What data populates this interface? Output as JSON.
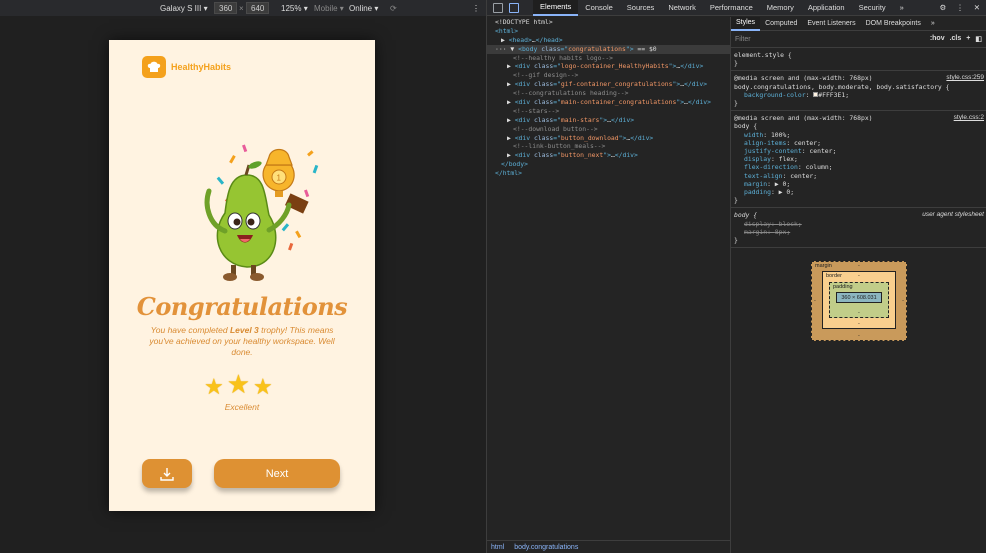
{
  "devbar": {
    "device": "Galaxy S III",
    "width": "360",
    "times": "×",
    "height": "640",
    "zoom": "125%",
    "mode": "Mobile",
    "throttle": "Online"
  },
  "app": {
    "logo_text": "HealthyHabits",
    "heading": "Congratulations",
    "message_pre": "You have completed ",
    "message_bold": "Level 3",
    "message_post": " trophy! This means you've achieved on your healthy workspace. Well done.",
    "rating_label": "Excellent",
    "next_label": "Next",
    "stars": [
      "★",
      "★",
      "★"
    ],
    "colors": {
      "background": "#FFF3E1",
      "accent": "#DE9133",
      "brand": "#F4A11C"
    }
  },
  "devtools": {
    "tabs": [
      "Elements",
      "Console",
      "Sources",
      "Network",
      "Performance",
      "Memory",
      "Application",
      "Security",
      "»"
    ],
    "elements_lines": [
      {
        "indent": 0,
        "parts": [
          [
            "tx",
            "<!DOCTYPE html>"
          ]
        ]
      },
      {
        "indent": 0,
        "parts": [
          [
            "tg",
            "<html>"
          ]
        ]
      },
      {
        "indent": 1,
        "parts": [
          [
            "tx",
            "▶ "
          ],
          [
            "tg",
            "<head>"
          ],
          [
            "tx",
            "…"
          ],
          [
            "tg",
            "</head>"
          ]
        ]
      },
      {
        "indent": 0,
        "sel": true,
        "parts": [
          [
            "tx",
            "··· ▼ "
          ],
          [
            "tg",
            "<body "
          ],
          [
            "an",
            "class"
          ],
          [
            "tg",
            "=\""
          ],
          [
            "av",
            "congratulations"
          ],
          [
            "tg",
            "\">"
          ],
          [
            "tx",
            " == $0"
          ]
        ]
      },
      {
        "indent": 3,
        "parts": [
          [
            "cm",
            "<!--healthy habits logo-->"
          ]
        ]
      },
      {
        "indent": 2,
        "parts": [
          [
            "tx",
            "▶ "
          ],
          [
            "tg",
            "<div "
          ],
          [
            "an",
            "class"
          ],
          [
            "tg",
            "=\""
          ],
          [
            "av",
            "logo-container_HealthyHabits"
          ],
          [
            "tg",
            "\">"
          ],
          [
            "tx",
            "…"
          ],
          [
            "tg",
            "</div>"
          ]
        ]
      },
      {
        "indent": 3,
        "parts": [
          [
            "cm",
            "<!--gif design-->"
          ]
        ]
      },
      {
        "indent": 2,
        "parts": [
          [
            "tx",
            "▶ "
          ],
          [
            "tg",
            "<div "
          ],
          [
            "an",
            "class"
          ],
          [
            "tg",
            "=\""
          ],
          [
            "av",
            "gif-container_congratulations"
          ],
          [
            "tg",
            "\">"
          ],
          [
            "tx",
            "…"
          ],
          [
            "tg",
            "</div>"
          ]
        ]
      },
      {
        "indent": 3,
        "parts": [
          [
            "cm",
            "<!--congratulations heading-->"
          ]
        ]
      },
      {
        "indent": 2,
        "parts": [
          [
            "tx",
            "▶ "
          ],
          [
            "tg",
            "<div "
          ],
          [
            "an",
            "class"
          ],
          [
            "tg",
            "=\""
          ],
          [
            "av",
            "main-container_congratulations"
          ],
          [
            "tg",
            "\">"
          ],
          [
            "tx",
            "…"
          ],
          [
            "tg",
            "</div>"
          ]
        ]
      },
      {
        "indent": 3,
        "parts": [
          [
            "cm",
            "<!--stars-->"
          ]
        ]
      },
      {
        "indent": 2,
        "parts": [
          [
            "tx",
            "▶ "
          ],
          [
            "tg",
            "<div "
          ],
          [
            "an",
            "class"
          ],
          [
            "tg",
            "=\""
          ],
          [
            "av",
            "main-stars"
          ],
          [
            "tg",
            "\">"
          ],
          [
            "tx",
            "…"
          ],
          [
            "tg",
            "</div>"
          ]
        ]
      },
      {
        "indent": 3,
        "parts": [
          [
            "cm",
            "<!--download button-->"
          ]
        ]
      },
      {
        "indent": 2,
        "parts": [
          [
            "tx",
            "▶ "
          ],
          [
            "tg",
            "<div "
          ],
          [
            "an",
            "class"
          ],
          [
            "tg",
            "=\""
          ],
          [
            "av",
            "button_download"
          ],
          [
            "tg",
            "\">"
          ],
          [
            "tx",
            "…"
          ],
          [
            "tg",
            "</div>"
          ]
        ]
      },
      {
        "indent": 3,
        "parts": [
          [
            "cm",
            "<!--link-button_meals-->"
          ]
        ]
      },
      {
        "indent": 2,
        "parts": [
          [
            "tx",
            "▶ "
          ],
          [
            "tg",
            "<div "
          ],
          [
            "an",
            "class"
          ],
          [
            "tg",
            "=\""
          ],
          [
            "av",
            "button_next"
          ],
          [
            "tg",
            "\">"
          ],
          [
            "tx",
            "…"
          ],
          [
            "tg",
            "</div>"
          ]
        ]
      },
      {
        "indent": 1,
        "parts": [
          [
            "tg",
            "</body>"
          ]
        ]
      },
      {
        "indent": 0,
        "parts": [
          [
            "tg",
            "</html>"
          ]
        ]
      }
    ],
    "breadcrumbs": [
      "html",
      "body.congratulations"
    ],
    "style_tabs": [
      "Styles",
      "Computed",
      "Event Listeners",
      "DOM Breakpoints",
      "»"
    ],
    "filter_placeholder": "Filter",
    "filter_hov": ":hov",
    "filter_cls": ".cls",
    "filter_plus": "+",
    "rule1": {
      "selector": "element.style {",
      "close": "}"
    },
    "rule2": {
      "media": "@media screen and (max-width: 768px)",
      "selector": "body.congratulations, body.moderate, body.satisfactory {",
      "source": "style.css:259",
      "prop": "background-color",
      "value": "#FFF3E1",
      "close": "}"
    },
    "rule3": {
      "media": "@media screen and (max-width: 768px)",
      "selector": "body {",
      "source": "style.css:2",
      "props": [
        {
          "name": "width",
          "value": "100%"
        },
        {
          "name": "align-items",
          "value": "center"
        },
        {
          "name": "justify-content",
          "value": "center"
        },
        {
          "name": "display",
          "value": "flex"
        },
        {
          "name": "flex-direction",
          "value": "column"
        },
        {
          "name": "text-align",
          "value": "center"
        },
        {
          "name": "margin",
          "value": "▶ 0"
        },
        {
          "name": "padding",
          "value": "▶ 0"
        }
      ],
      "close": "}"
    },
    "rule4": {
      "selector": "body {",
      "source": "user agent stylesheet",
      "props": [
        {
          "name": "display",
          "value": "block"
        },
        {
          "name": "margin",
          "value": "8px"
        }
      ],
      "close": "}"
    },
    "boxmodel": {
      "margin_label": "margin",
      "border_label": "border",
      "padding_label": "padding",
      "dash": "-",
      "content": "360 × 608.031"
    }
  }
}
